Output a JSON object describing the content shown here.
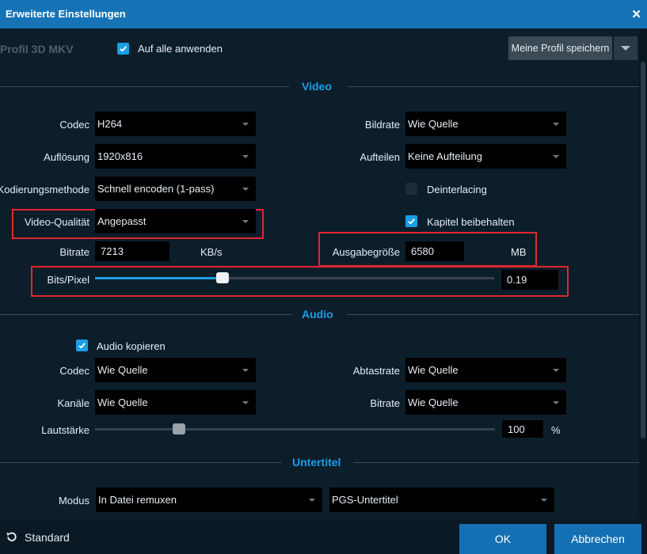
{
  "window": {
    "title": "Erweiterte Einstellungen"
  },
  "colors": {
    "accent": "#1b9ee6",
    "titlebar": "#1673b5",
    "highlight_box": "#e0262c"
  },
  "profile": {
    "name": "Profil 3D MKV",
    "apply_all_label": "Auf alle anwenden",
    "apply_all_checked": true,
    "save_label": "Meine Profil speichern"
  },
  "video": {
    "section_title": "Video",
    "codec": {
      "label": "Codec",
      "value": "H264"
    },
    "resolution": {
      "label": "Auflösung",
      "value": "1920x816"
    },
    "encoding_method": {
      "label": "Kodierungsmethode",
      "value": "Schnell encoden (1-pass)"
    },
    "quality": {
      "label": "Video-Qualität",
      "value": "Angepasst"
    },
    "bitrate": {
      "label": "Bitrate",
      "value": "7213",
      "unit": "KB/s"
    },
    "framerate": {
      "label": "Bildrate",
      "value": "Wie Quelle"
    },
    "split": {
      "label": "Aufteilen",
      "value": "Keine Aufteilung"
    },
    "deinterlacing": {
      "label": "Deinterlacing",
      "checked": false
    },
    "keep_chapters": {
      "label": "Kapitel beibehalten",
      "checked": true
    },
    "output_size": {
      "label": "Ausgabegröße",
      "value": "6580",
      "unit": "MB"
    },
    "bits_per_pixel": {
      "label": "Bits/Pixel",
      "value": "0.19",
      "slider_fraction": 0.32
    }
  },
  "audio": {
    "section_title": "Audio",
    "copy_label": "Audio kopieren",
    "copy_checked": true,
    "codec": {
      "label": "Codec",
      "value": "Wie Quelle"
    },
    "channels": {
      "label": "Kanäle",
      "value": "Wie Quelle"
    },
    "sample_rate": {
      "label": "Abtastrate",
      "value": "Wie Quelle"
    },
    "bitrate": {
      "label": "Bitrate",
      "value": "Wie Quelle"
    },
    "volume": {
      "label": "Lautstärke",
      "value": "100",
      "unit": "%",
      "slider_fraction": 0.21
    }
  },
  "subtitles": {
    "section_title": "Untertitel",
    "mode": {
      "label": "Modus",
      "value": "In Datei remuxen"
    },
    "type": {
      "value": "PGS-Untertitel"
    }
  },
  "footer": {
    "standard_label": "Standard",
    "ok_label": "OK",
    "cancel_label": "Abbrechen"
  }
}
